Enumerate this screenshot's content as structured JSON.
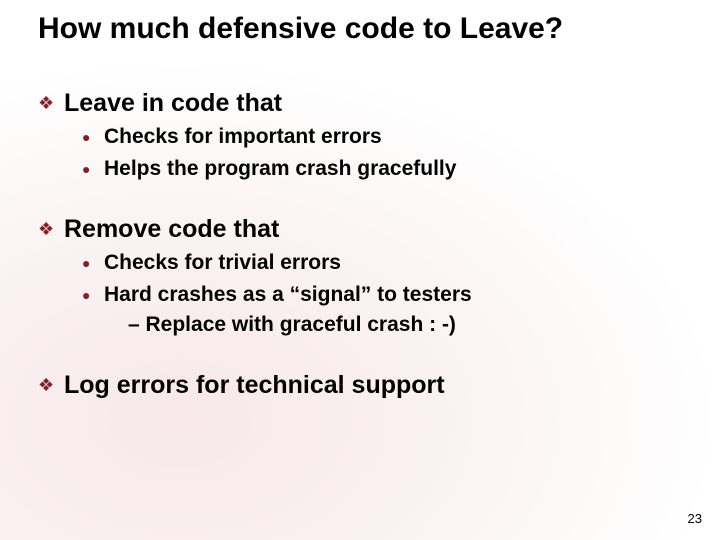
{
  "slide": {
    "title": "How much defensive code to Leave?",
    "sections": [
      {
        "heading": "Leave in code that",
        "items": [
          {
            "text": "Checks for important errors"
          },
          {
            "text": "Helps the program crash gracefully"
          }
        ]
      },
      {
        "heading": "Remove code that",
        "items": [
          {
            "text": "Checks for trivial errors"
          },
          {
            "text": "Hard crashes as a “signal” to testers",
            "sub": "– Replace with graceful crash : -)"
          }
        ]
      },
      {
        "heading": "Log errors for technical support",
        "items": []
      }
    ],
    "page_number": "23"
  },
  "glyphs": {
    "diamond": "❖",
    "dot": "●"
  }
}
